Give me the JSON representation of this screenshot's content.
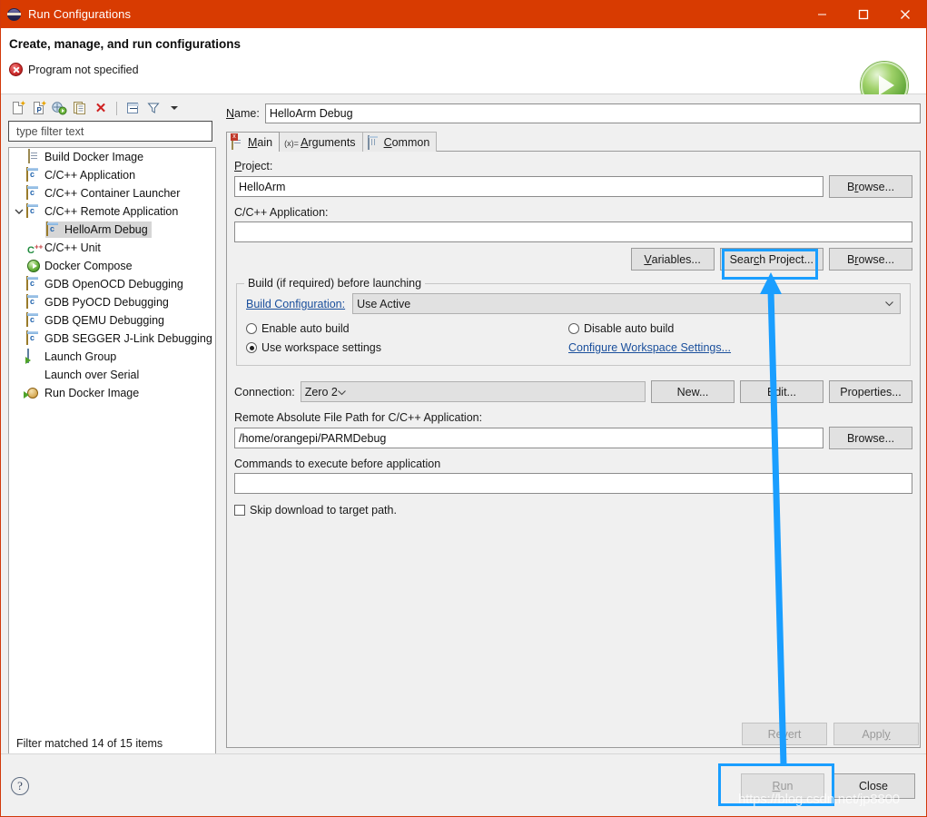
{
  "window": {
    "title": "Run Configurations",
    "icon": "eclipse-globe-icon",
    "controls": {
      "minimize": "minimize-icon",
      "maximize": "maximize-icon",
      "close": "close-icon"
    },
    "titlebar_color": "#d83b01"
  },
  "header": {
    "title": "Create, manage, and run configurations",
    "status": "Program not specified",
    "status_icon": "error-icon",
    "run_icon": "run-play-icon"
  },
  "left": {
    "toolbar": [
      {
        "name": "new-configuration-icon",
        "glyph": "new-doc"
      },
      {
        "name": "new-prototype-icon",
        "glyph": "new-proto"
      },
      {
        "name": "export-icon",
        "glyph": "export"
      },
      {
        "name": "duplicate-icon",
        "glyph": "duplicate"
      },
      {
        "name": "delete-icon",
        "glyph": "delete"
      },
      {
        "name": "collapse-all-icon",
        "glyph": "collapse"
      },
      {
        "name": "filter-icon",
        "glyph": "funnel"
      },
      {
        "name": "view-menu-icon",
        "glyph": "caret"
      }
    ],
    "filter": {
      "value": "",
      "placeholder": "type filter text"
    },
    "tree": [
      {
        "label": "Build Docker Image",
        "icon": "docker-image-icon",
        "indent": 0,
        "twisty": "none",
        "selected": false
      },
      {
        "label": "C/C++ Application",
        "icon": "cpp-launch-icon",
        "indent": 0,
        "twisty": "none",
        "selected": false
      },
      {
        "label": "C/C++ Container Launcher",
        "icon": "cpp-launch-icon",
        "indent": 0,
        "twisty": "none",
        "selected": false
      },
      {
        "label": "C/C++ Remote Application",
        "icon": "cpp-launch-icon",
        "indent": 0,
        "twisty": "expanded",
        "selected": false
      },
      {
        "label": "HelloArm Debug",
        "icon": "cpp-launch-icon",
        "indent": 1,
        "twisty": "none",
        "selected": true
      },
      {
        "label": "C/C++ Unit",
        "icon": "cunit-icon",
        "indent": 0,
        "twisty": "none",
        "selected": false
      },
      {
        "label": "Docker Compose",
        "icon": "play-circle-icon",
        "indent": 0,
        "twisty": "none",
        "selected": false
      },
      {
        "label": "GDB OpenOCD Debugging",
        "icon": "cpp-launch-icon",
        "indent": 0,
        "twisty": "none",
        "selected": false
      },
      {
        "label": "GDB PyOCD Debugging",
        "icon": "cpp-launch-icon",
        "indent": 0,
        "twisty": "none",
        "selected": false
      },
      {
        "label": "GDB QEMU Debugging",
        "icon": "cpp-launch-icon",
        "indent": 0,
        "twisty": "none",
        "selected": false
      },
      {
        "label": "GDB SEGGER J-Link Debugging",
        "icon": "cpp-launch-icon",
        "indent": 0,
        "twisty": "none",
        "selected": false
      },
      {
        "label": "Launch Group",
        "icon": "launch-group-icon",
        "indent": 0,
        "twisty": "none",
        "selected": false
      },
      {
        "label": "Launch over Serial",
        "icon": "none",
        "indent": 0,
        "twisty": "none",
        "selected": false
      },
      {
        "label": "Run Docker Image",
        "icon": "run-docker-icon",
        "indent": 0,
        "twisty": "none",
        "selected": false
      }
    ],
    "status": "Filter matched 14 of 15 items"
  },
  "right": {
    "name_label": "Name:",
    "name_value": "HelloArm Debug",
    "tabs": [
      {
        "label": "Main",
        "icon": "main-tab-icon",
        "active": true
      },
      {
        "label": "Arguments",
        "icon": "arguments-tab-icon",
        "active": false
      },
      {
        "label": "Common",
        "icon": "common-tab-icon",
        "active": false
      }
    ],
    "project": {
      "label": "Project:",
      "value": "HelloArm",
      "browse_label": "Browse..."
    },
    "application": {
      "label": "C/C++ Application:",
      "value": "",
      "variables_label": "Variables...",
      "search_project_label": "Search Project...",
      "browse_label": "Browse..."
    },
    "build_group": {
      "legend": "Build (if required) before launching",
      "build_config_link": "Build Configuration:",
      "build_config_value": "Use Active",
      "radios": [
        {
          "label": "Enable auto build",
          "selected": false
        },
        {
          "label": "Disable auto build",
          "selected": false
        },
        {
          "label": "Use workspace settings",
          "selected": true
        }
      ],
      "configure_link": "Configure Workspace Settings..."
    },
    "connection": {
      "label": "Connection:",
      "value": "Zero 2",
      "new_label": "New...",
      "edit_label": "Edit...",
      "properties_label": "Properties..."
    },
    "remote_path": {
      "label": "Remote Absolute File Path for C/C++ Application:",
      "value": "/home/orangepi/PARMDebug",
      "browse_label": "Browse..."
    },
    "commands": {
      "label": "Commands to execute before application",
      "value": ""
    },
    "skip_download": {
      "label": "Skip download to target path.",
      "checked": false
    },
    "revert_label": "Revert",
    "apply_label": "Apply"
  },
  "footer": {
    "help_icon": "help-icon",
    "run_label": "Run",
    "close_label": "Close"
  },
  "annotation": {
    "highlight_color": "#1a9eff",
    "arrow_from": "Run",
    "arrow_to": "Search Project..."
  },
  "watermark": "https://blog.csdn.net/jp8800"
}
